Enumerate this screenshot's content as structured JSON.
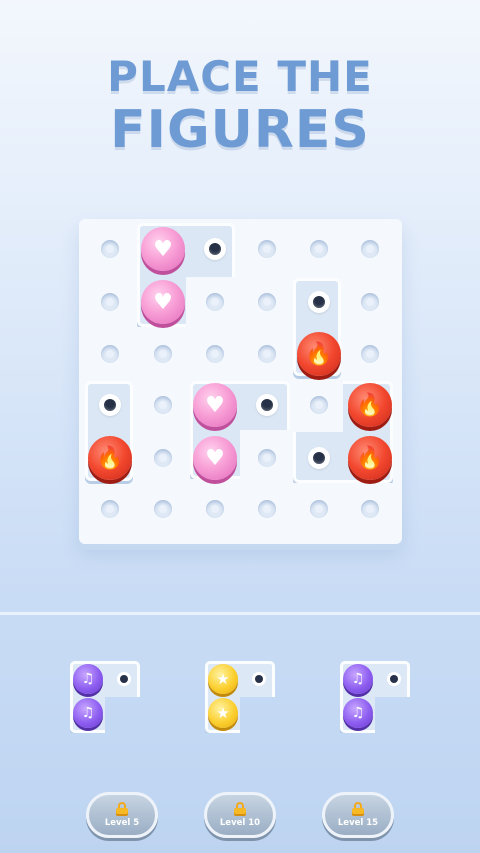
{
  "header": {
    "line1": "PLACE THE",
    "line2": "FIGURES"
  },
  "board": {
    "columns": 6,
    "rows": 6
  },
  "icons": {
    "heart": "heart-icon",
    "flame": "flame-icon",
    "note": "music-note-icon",
    "star": "star-icon"
  },
  "colors": {
    "pink": "#f89fd6",
    "red": "#f2472e",
    "purple": "#8d5df0",
    "gold": "#fbcf2e",
    "title": "#6e9bd4"
  },
  "glyphs": {
    "heart": "♥",
    "flame": "🔥",
    "note": "♫",
    "star": "★"
  },
  "pieces": [
    {
      "name": "purple-music-piece",
      "color": "purple",
      "icon": "music-note-icon"
    },
    {
      "name": "gold-star-piece",
      "color": "gold",
      "icon": "star-icon"
    },
    {
      "name": "purple-music-piece-2",
      "color": "purple",
      "icon": "music-note-icon"
    }
  ],
  "levels": [
    {
      "label": "Level 5",
      "locked": true
    },
    {
      "label": "Level 10",
      "locked": true
    },
    {
      "label": "Level 15",
      "locked": true
    }
  ]
}
